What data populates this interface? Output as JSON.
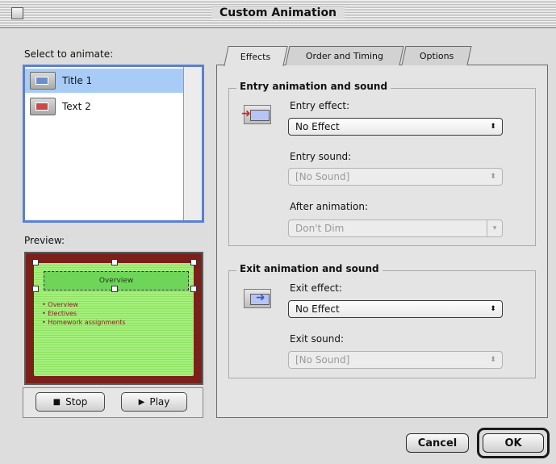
{
  "window": {
    "title": "Custom Animation"
  },
  "left_panel": {
    "select_label": "Select to animate:",
    "items": [
      {
        "label": "Title 1",
        "selected": true
      },
      {
        "label": "Text 2",
        "selected": false
      }
    ],
    "preview_label": "Preview:",
    "preview_slide": {
      "title": "Overview",
      "bullets": [
        "Overview",
        "Electives",
        "Homework assignments"
      ]
    },
    "stop_label": "Stop",
    "play_label": "Play"
  },
  "tabs": [
    {
      "label": "Effects",
      "active": true
    },
    {
      "label": "Order and Timing",
      "active": false
    },
    {
      "label": "Options",
      "active": false
    }
  ],
  "entry_group": {
    "title": "Entry animation and sound",
    "effect_label": "Entry effect:",
    "effect_value": "No Effect",
    "sound_label": "Entry sound:",
    "sound_value": "[No Sound]",
    "after_label": "After animation:",
    "after_value": "Don't Dim"
  },
  "exit_group": {
    "title": "Exit animation and sound",
    "effect_label": "Exit effect:",
    "effect_value": "No Effect",
    "sound_label": "Exit sound:",
    "sound_value": "[No Sound]"
  },
  "buttons": {
    "cancel": "Cancel",
    "ok": "OK"
  },
  "icons": {
    "entry_effect_icon": "slide-entry-arrow-icon",
    "exit_effect_icon": "slide-exit-arrow-icon",
    "close_box": "close-box-icon",
    "stop": "stop-icon",
    "play": "play-icon",
    "popup_arrow": "updown-arrow-icon",
    "dropdown_arrow": "chevron-down-icon"
  },
  "colors": {
    "selection": "#a9ccf6",
    "focus_ring": "#5b7fd6",
    "slide_background": "#7b1f1a",
    "slide_content": "#a4f07c"
  }
}
